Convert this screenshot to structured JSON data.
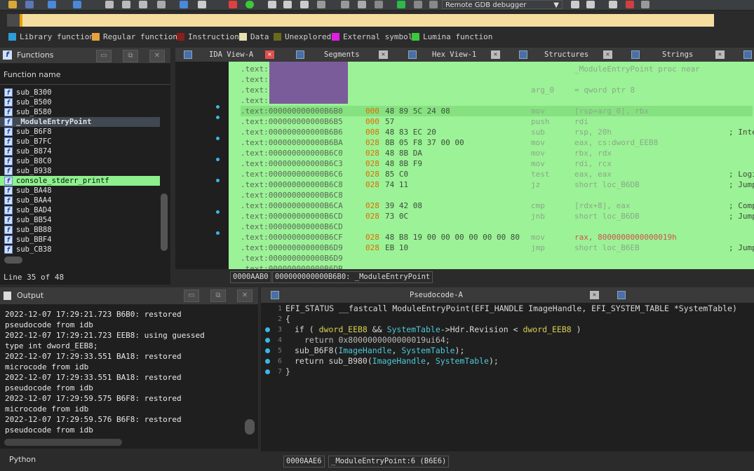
{
  "toolbar": {
    "debugger_label": "Remote GDB debugger"
  },
  "colors": {
    "library_function": "#2d9cdb",
    "regular_function": "#e8a23c",
    "instruction": "#8b1e1e",
    "data": "#e8e0b0",
    "unexplored": "#6a6a1e",
    "external_symbol": "#e020e0",
    "lumina_function": "#3cc83c",
    "highlight": "#8cf08c",
    "disasm_bg": "#9cf296"
  },
  "legend": [
    "Library function",
    "Regular function",
    "Instruction",
    "Data",
    "Unexplored",
    "External symbol",
    "Lumina function"
  ],
  "functions": {
    "title": "Functions",
    "column": "Function name",
    "items": [
      "sub_B300",
      "sub_B500",
      "sub_B580",
      "_ModuleEntryPoint",
      "sub_B6F8",
      "sub_B7FC",
      "sub_B874",
      "sub_B8C0",
      "sub_B938",
      "console_stderr_printf",
      "sub_BA48",
      "sub_BAA4",
      "sub_BAD4",
      "sub_BB54",
      "sub_BB88",
      "sub_BBF4",
      "sub_CB38"
    ],
    "status": "Line 35 of 48"
  },
  "tabs": {
    "ida_view": "IDA View-A",
    "segments": "Segments",
    "hex_view": "Hex View-1",
    "structures": "Structures",
    "strings": "Strings",
    "pseudocode": "Pseudocode-A"
  },
  "disasm": {
    "lines": [
      {
        "addr": ".text:",
        "sp": "",
        "bytes": "",
        "mn": "",
        "op": "_ModuleEntryPoint proc near",
        "cm": ""
      },
      {
        "addr": ".text:",
        "sp": "",
        "bytes": "",
        "mn": "",
        "op": "",
        "cm": ""
      },
      {
        "addr": ".text:",
        "sp": "",
        "bytes": "",
        "mn": "arg_0",
        "op": "= qword ptr  8",
        "cm": ""
      },
      {
        "addr": ".text:",
        "sp": "",
        "bytes": "",
        "mn": "",
        "op": "",
        "cm": ""
      },
      {
        "addr": ".text:000000000000B6B0",
        "sp": "000",
        "bytes": "48 89 5C 24 08",
        "mn": "mov",
        "op": "[rsp+arg_0], rbx",
        "cm": ""
      },
      {
        "addr": ".text:000000000000B6B5",
        "sp": "000",
        "bytes": "57",
        "mn": "push",
        "op": "rdi",
        "cm": ""
      },
      {
        "addr": ".text:000000000000B6B6",
        "sp": "008",
        "bytes": "48 83 EC 20",
        "mn": "sub",
        "op": "rsp, 20h",
        "cm": "; Intege"
      },
      {
        "addr": ".text:000000000000B6BA",
        "sp": "028",
        "bytes": "8B 05 F8 37 00 00",
        "mn": "mov",
        "op": "eax, cs:dword_EEB8",
        "cm": ""
      },
      {
        "addr": ".text:000000000000B6C0",
        "sp": "028",
        "bytes": "48 8B DA",
        "mn": "mov",
        "op": "rbx, rdx",
        "cm": ""
      },
      {
        "addr": ".text:000000000000B6C3",
        "sp": "028",
        "bytes": "48 8B F9",
        "mn": "mov",
        "op": "rdi, rcx",
        "cm": ""
      },
      {
        "addr": ".text:000000000000B6C6",
        "sp": "028",
        "bytes": "85 C0",
        "mn": "test",
        "op": "eax, eax",
        "cm": "; Logica"
      },
      {
        "addr": ".text:000000000000B6C8",
        "sp": "028",
        "bytes": "74 11",
        "mn": "jz",
        "op": "short loc_B6DB",
        "cm": "; Jump i"
      },
      {
        "addr": ".text:000000000000B6C8",
        "sp": "",
        "bytes": "",
        "mn": "",
        "op": "",
        "cm": ""
      },
      {
        "addr": ".text:000000000000B6CA",
        "sp": "028",
        "bytes": "39 42 08",
        "mn": "cmp",
        "op": "[rdx+8], eax",
        "cm": "; Compar"
      },
      {
        "addr": ".text:000000000000B6CD",
        "sp": "028",
        "bytes": "73 0C",
        "mn": "jnb",
        "op": "short loc_B6DB",
        "cm": "; Jump i"
      },
      {
        "addr": ".text:000000000000B6CD",
        "sp": "",
        "bytes": "",
        "mn": "",
        "op": "",
        "cm": ""
      },
      {
        "addr": ".text:000000000000B6CF",
        "sp": "028",
        "bytes": "48 B8 19 00 00 00 00 00 00 80",
        "mn": "mov",
        "op": "rax, 8000000000000019h",
        "cm": ""
      },
      {
        "addr": ".text:000000000000B6D9",
        "sp": "028",
        "bytes": "EB 10",
        "mn": "jmp",
        "op": "short loc_B6EB",
        "cm": "; Jump"
      },
      {
        "addr": ".text:000000000000B6D9",
        "sp": "",
        "bytes": "",
        "mn": "",
        "op": "",
        "cm": ""
      },
      {
        "addr": ".text:000000000000B6DB",
        "sp": "",
        "bytes": "",
        "mn": "",
        "op": "",
        "cm": ""
      }
    ],
    "status_offset": "0000AAB0",
    "status_addr": "000000000000B6B0: _ModuleEntryPoint"
  },
  "output": {
    "title": "Output",
    "lines": [
      "2022-12-07 17:29:21.723 B6B0: restored",
      "pseudocode from idb",
      "2022-12-07 17:29:21.723 EEB8: using guessed",
      "type int dword_EEB8;",
      "2022-12-07 17:29:33.551 BA18: restored",
      "microcode from idb",
      "2022-12-07 17:29:33.551 BA18: restored",
      "pseudocode from idb",
      "2022-12-07 17:29:59.575 B6F8: restored",
      "microcode from idb",
      "2022-12-07 17:29:59.576 B6F8: restored",
      "pseudocode from idb"
    ],
    "python_label": "Python"
  },
  "pseudocode": {
    "line_numbers": [
      "1",
      "2",
      "3",
      "4",
      "5",
      "6",
      "7"
    ],
    "signature": "EFI_STATUS __fastcall ModuleEntryPoint(EFI_HANDLE ImageHandle, EFI_SYSTEM_TABLE *SystemTable)",
    "line2": "{",
    "line3_a": "if ( ",
    "line3_g1": "dword_EEB8",
    "line3_b": " && ",
    "line3_v": "SystemTable",
    "line3_c": "->Hdr.Revision < ",
    "line3_g2": "dword_EEB8",
    "line3_d": " )",
    "line4": "return 0x8000000000000019ui64;",
    "line5_f": "sub_B6F8(",
    "line5_a1": "ImageHandle",
    "line5_sep": ", ",
    "line5_a2": "SystemTable",
    "line5_end": ");",
    "line6_r": "return sub_B980(",
    "line6_a1": "ImageHandle",
    "line6_sep": ", ",
    "line6_a2": "SystemTable",
    "line6_end": ");",
    "line7": "}",
    "status_offset": "0000AAE6",
    "status_loc": "_ModuleEntryPoint:6 (B6E6)"
  }
}
